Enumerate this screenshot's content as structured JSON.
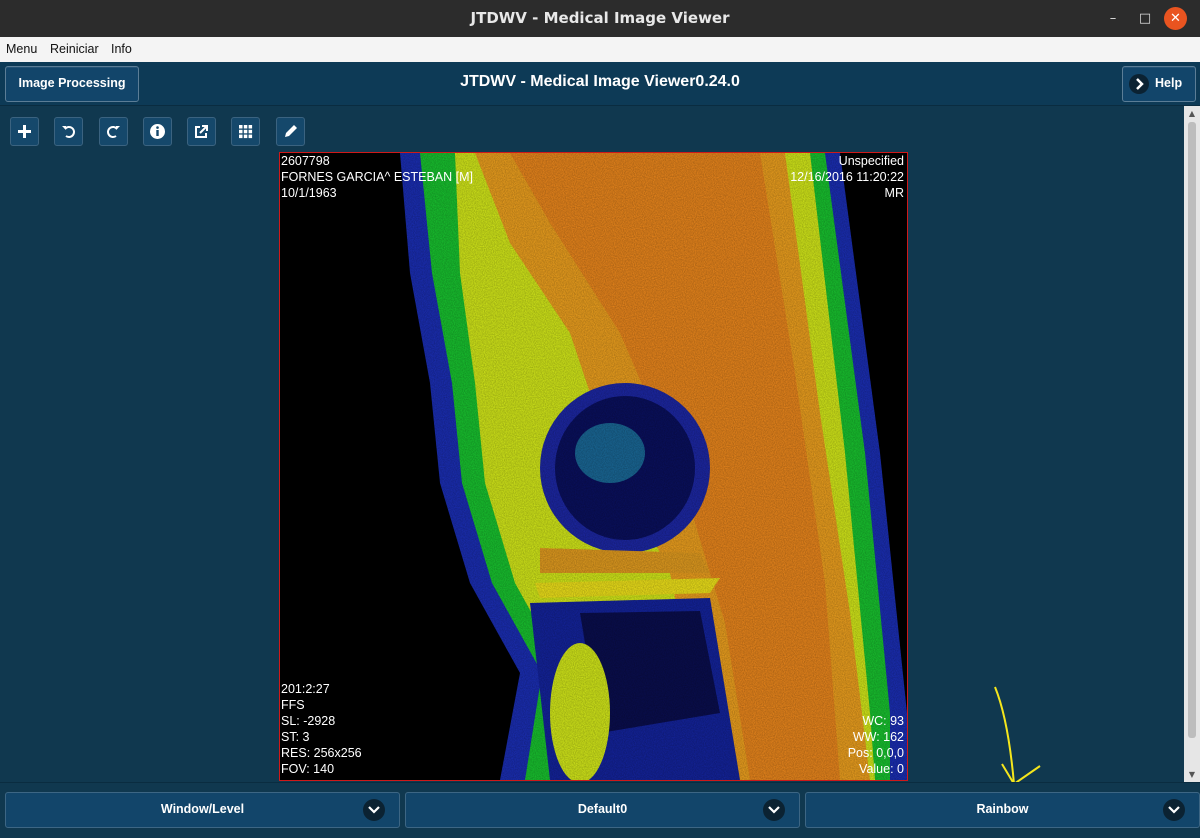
{
  "window": {
    "title": "JTDWV - Medical Image Viewer",
    "minimize": "–",
    "maximize": "□",
    "close": "✕"
  },
  "menubar": {
    "items": [
      "Menu",
      "Reiniciar",
      "Info"
    ]
  },
  "header": {
    "left_button": "Image Processing",
    "app_title": "JTDWV - Medical Image Viewer0.24.0",
    "help_button": "Help"
  },
  "toolbar": {
    "icons": [
      "plus-icon",
      "undo-icon",
      "redo-icon",
      "info-icon",
      "export-icon",
      "grid-icon",
      "pencil-icon"
    ]
  },
  "overlay": {
    "top_left": [
      "2607798",
      "FORNES GARCIA^ ESTEBAN [M]",
      "10/1/1963"
    ],
    "top_right": [
      "Unspecified",
      "12/16/2016 11:20:22",
      "MR"
    ],
    "bottom_left": [
      "201:2:27",
      "FFS",
      "SL: -2928",
      "ST: 3",
      "RES: 256x256",
      "FOV: 140"
    ],
    "bottom_right": [
      "WC: 93",
      "WW: 162",
      "Pos: 0,0,0",
      "Value: 0"
    ]
  },
  "bottom_bar": {
    "window_level": "Window/Level",
    "preset": "Default0",
    "colormap": "Rainbow"
  },
  "colors": {
    "background": "#10384f",
    "button": "#12456a",
    "viewer_border": "#d01919",
    "annotation_arrow": "#f5e61c"
  }
}
